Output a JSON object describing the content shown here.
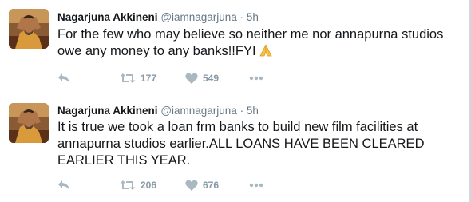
{
  "tweets": [
    {
      "name": "Nagarjuna Akkineni",
      "handle": "@iamnagarjuna",
      "separator": "·",
      "time": "5h",
      "text": "For the few who may believe so neither me nor annapurna studios owe any money to any banks!!FYI",
      "emoji_icon": "folded-hands-icon",
      "retweets": "177",
      "likes": "549"
    },
    {
      "name": "Nagarjuna Akkineni",
      "handle": "@iamnagarjuna",
      "separator": "·",
      "time": "5h",
      "text": "It is true we took a loan frm banks to build new film facilities at annapurna studios earlier.ALL LOANS HAVE BEEN CLEARED EARLIER THIS YEAR.",
      "retweets": "206",
      "likes": "676"
    }
  ],
  "colors": {
    "text": "#14171a",
    "secondary": "#657786",
    "action_icon": "#aab8c2",
    "divider": "#e1e8ed"
  }
}
